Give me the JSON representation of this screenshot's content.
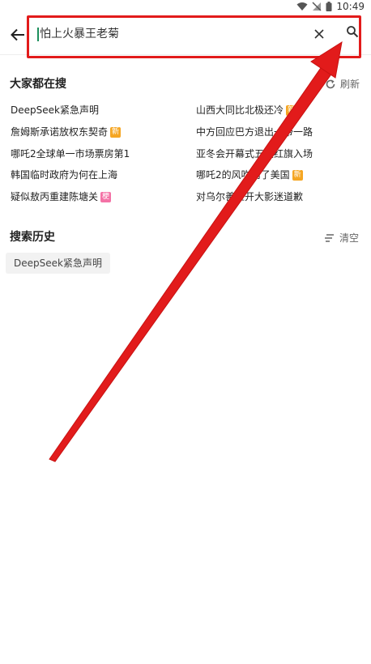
{
  "status_bar": {
    "time": "10:49"
  },
  "search": {
    "value": "怕上火暴王老菊"
  },
  "hot_searches": {
    "title": "大家都在搜",
    "refresh_label": "刷新",
    "items": [
      {
        "text": "DeepSeek紧急声明",
        "badge": ""
      },
      {
        "text": "山西大同比北极还冷",
        "badge": "新",
        "badge_type": "new"
      },
      {
        "text": "詹姆斯承诺放权东契奇",
        "badge": "新",
        "badge_type": "new"
      },
      {
        "text": "中方回应巴方退出一带一路",
        "badge": ""
      },
      {
        "text": "哪吒2全球单一市场票房第1",
        "badge": ""
      },
      {
        "text": "亚冬会开幕式五星红旗入场",
        "badge": ""
      },
      {
        "text": "韩国临时政府为何在上海",
        "badge": ""
      },
      {
        "text": "哪吒2的风吹到了美国",
        "badge": "新",
        "badge_type": "new"
      },
      {
        "text": "疑似敖丙重建陈塘关",
        "badge": "梗",
        "badge_type": "meme"
      },
      {
        "text": "对乌尔善脸开大影迷道歉",
        "badge": ""
      }
    ]
  },
  "history": {
    "title": "搜索历史",
    "clear_label": "清空",
    "items": [
      "DeepSeek紧急声明"
    ]
  },
  "colors": {
    "annotation_red": "#e21b1b",
    "badge_new": "#f5a623",
    "badge_hot": "#f472a6",
    "caret": "#1d8f5c"
  },
  "icons": [
    "wifi-icon",
    "signal-icon",
    "battery-icon",
    "back-arrow-icon",
    "clear-x-icon",
    "search-icon",
    "refresh-icon",
    "clear-list-icon"
  ]
}
